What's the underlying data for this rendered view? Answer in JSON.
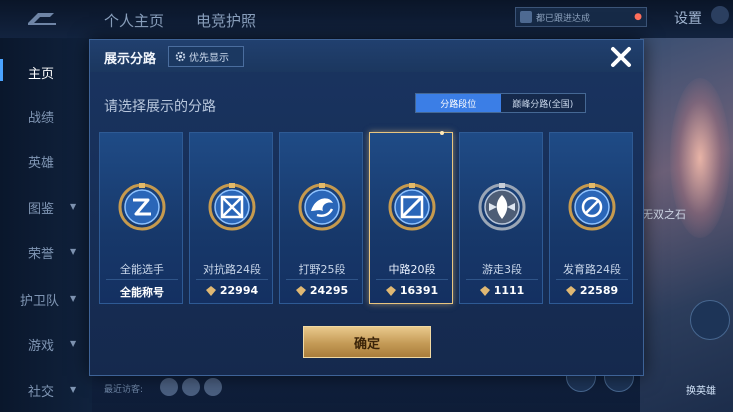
{
  "background": {
    "tabs": [
      "个人主页",
      "电竞护照"
    ],
    "settings_label": "设置",
    "user_banner": "都已跟进达成",
    "sidebar": [
      {
        "label": "主页",
        "caret": false,
        "active": true
      },
      {
        "label": "战绩",
        "caret": false
      },
      {
        "label": "英雄",
        "caret": false
      },
      {
        "label": "图鉴",
        "caret": true
      },
      {
        "label": "荣誉",
        "caret": true
      },
      {
        "label": "护卫队",
        "caret": true
      },
      {
        "label": "游戏",
        "caret": true
      },
      {
        "label": "社交",
        "caret": true
      }
    ],
    "side_text": "无双之石",
    "swap_label": "换英雄",
    "recent_label": "最近访客:"
  },
  "dialog": {
    "title": "展示分路",
    "priority_label": "优先显示",
    "subtitle": "请选择展示的分路",
    "toggle": [
      "分路段位",
      "巅峰分路(全国)"
    ],
    "toggle_active": 0,
    "cards": [
      {
        "label": "全能选手",
        "score": "全能称号",
        "icon": "all-round-icon",
        "selected": false,
        "has_score_icon": false
      },
      {
        "label": "对抗路24段",
        "score": "22994",
        "icon": "clash-lane-icon",
        "selected": false,
        "has_score_icon": true
      },
      {
        "label": "打野25段",
        "score": "24295",
        "icon": "jungle-icon",
        "selected": false,
        "has_score_icon": true
      },
      {
        "label": "中路20段",
        "score": "16391",
        "icon": "mid-lane-icon",
        "selected": true,
        "has_score_icon": true
      },
      {
        "label": "游走3段",
        "score": "1111",
        "icon": "roam-icon",
        "selected": false,
        "has_score_icon": true
      },
      {
        "label": "发育路24段",
        "score": "22589",
        "icon": "farm-lane-icon",
        "selected": false,
        "has_score_icon": true
      }
    ],
    "confirm_label": "确定"
  },
  "colors": {
    "accent": "#3b7ee6",
    "gold": "#e8c580",
    "card_bg": "#1f4b86",
    "dialog_bg": "#17305a"
  }
}
